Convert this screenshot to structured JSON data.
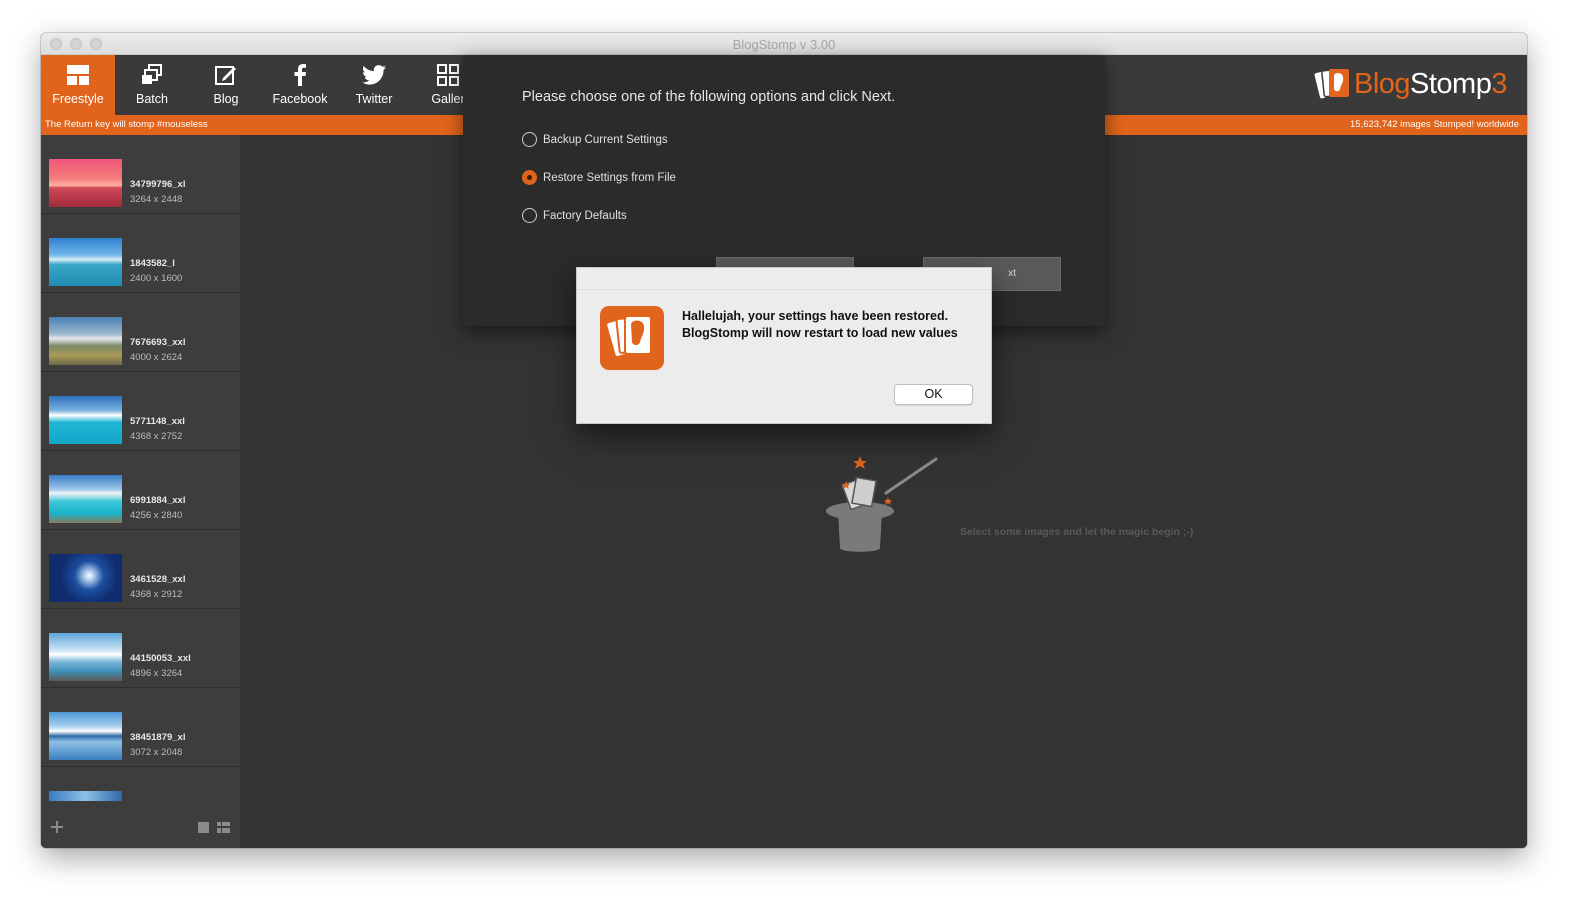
{
  "window": {
    "title": "BlogStomp v 3.00"
  },
  "toolbar": {
    "items": [
      {
        "label": "Freestyle",
        "icon": "freestyle-icon",
        "active": true
      },
      {
        "label": "Batch",
        "icon": "batch-icon",
        "active": false
      },
      {
        "label": "Blog",
        "icon": "blog-edit-icon",
        "active": false
      },
      {
        "label": "Facebook",
        "icon": "facebook-icon",
        "active": false
      },
      {
        "label": "Twitter",
        "icon": "twitter-icon",
        "active": false
      },
      {
        "label": "Galler",
        "icon": "gallery-grid-icon",
        "active": false
      }
    ]
  },
  "brand": {
    "blog": "Blog",
    "stomp": "Stomp",
    "three": "3"
  },
  "status_bar": {
    "left": "The Return key will stomp #mouseless",
    "right": "15,623,742 images Stomped! worldwide"
  },
  "sidebar": {
    "images": [
      {
        "name": "34799796_xl",
        "size": "3264 x 2448"
      },
      {
        "name": "1843582_l",
        "size": "2400 x 1600"
      },
      {
        "name": "7676693_xxl",
        "size": "4000 x 2624"
      },
      {
        "name": "5771148_xxl",
        "size": "4368 x 2752"
      },
      {
        "name": "6991884_xxl",
        "size": "4256 x 2840"
      },
      {
        "name": "3461528_xxl",
        "size": "4368 x 2912"
      },
      {
        "name": "44150053_xxl",
        "size": "4896 x 3264"
      },
      {
        "name": "38451879_xl",
        "size": "3072 x 2048"
      }
    ]
  },
  "main": {
    "hint": "Select some images and let the magic begin ;-)"
  },
  "sheet": {
    "prompt": "Please choose one of the following options and click Next.",
    "options": [
      {
        "label": "Backup Current Settings",
        "selected": false
      },
      {
        "label": "Restore Settings from File",
        "selected": true
      },
      {
        "label": "Factory Defaults",
        "selected": false
      }
    ],
    "next_partial": "xt"
  },
  "alert": {
    "line1": "Hallelujah, your settings have been restored.",
    "line2": "BlogStomp will now restart to load new values",
    "ok_label": "OK"
  },
  "colors": {
    "accent": "#e0641c",
    "toolbar_bg": "#3a3a3a",
    "main_bg": "#333333"
  }
}
